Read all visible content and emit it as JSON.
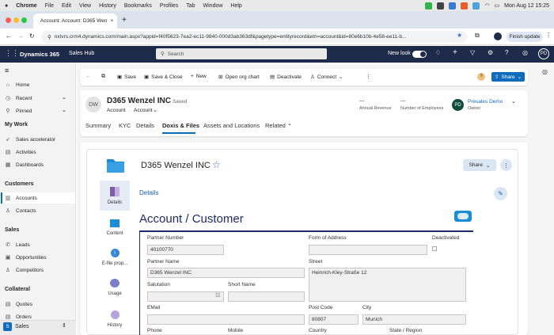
{
  "mac": {
    "apple": "",
    "app": "Chrome",
    "menu": [
      "File",
      "Edit",
      "View",
      "History",
      "Bookmarks",
      "Profiles",
      "Tab",
      "Window",
      "Help"
    ],
    "clock": "Mon Aug 12  15:25"
  },
  "tab": {
    "title": "Account: Account: D365 Wen",
    "close": "×",
    "new": "+"
  },
  "address": {
    "url": "nxtvrs.crm4.dynamics.com/main.aspx?appid=f40f5623-7ea2-ec11-9840-000d3ab363df&pagetype=entityrecord&etn=account&id=80e6b10b-4e58-ee11-b...",
    "finish": "Finish update"
  },
  "dyn": {
    "product": "Dynamics 365",
    "app": "Sales Hub",
    "search_placeholder": "Search",
    "new_look": "New look",
    "avatar": "PD"
  },
  "sidebar": {
    "home": "Home",
    "recent": "Recent",
    "pinned": "Pinned",
    "section_mywork": "My Work",
    "mywork": [
      "Sales accelerator",
      "Activities",
      "Dashboards"
    ],
    "section_customers": "Customers",
    "customers": [
      "Accounts",
      "Contacts"
    ],
    "section_sales": "Sales",
    "sales": [
      "Leads",
      "Opportunities",
      "Competitors"
    ],
    "section_collateral": "Collateral",
    "collateral": [
      "Quotes",
      "Orders"
    ],
    "area": "Sales",
    "area_badge": "S"
  },
  "commands": {
    "save": "Save",
    "save_close": "Save & Close",
    "new": "New",
    "org_chart": "Open org chart",
    "deactivate": "Deactivate",
    "connect": "Connect",
    "share": "Share"
  },
  "record": {
    "initials": "DW",
    "name": "D365 Wenzel INC",
    "saved": "- Saved",
    "type1": "Account",
    "type2": "Account",
    "revenue_value": "---",
    "revenue_label": "Annual Revenue",
    "employees_value": "---",
    "employees_label": "Number of Employees",
    "owner_initials": "PD",
    "owner_name": "Presales Demo",
    "owner_label": "Owner"
  },
  "tabs": [
    "Summary",
    "KYC",
    "Details",
    "Doxis & Files",
    "Assets and Locations",
    "Related"
  ],
  "doxis": {
    "title": "D365 Wenzel INC",
    "share": "Share",
    "nav": [
      "Details",
      "Content",
      "E-file prop...",
      "Usage",
      "History"
    ],
    "section": "Details",
    "form_title": "Account / Customer",
    "fields": {
      "partner_number_label": "Partner Number",
      "partner_number": "40100770",
      "form_of_address_label": "Form of Address",
      "form_of_address": "",
      "deactivated_label": "Deactivated",
      "partner_name_label": "Partner Name",
      "partner_name": "D365 Wenzel INC",
      "street_label": "Street",
      "street": "Heinrich-Kley-Straße 12",
      "salutation_label": "Salutation",
      "short_name_label": "Short Name",
      "email_label": "EMail",
      "post_code_label": "Post Code",
      "post_code": "80807",
      "city_label": "City",
      "city": "Munich",
      "phone_label": "Phone",
      "mobile_label": "Mobile",
      "country_label": "Country",
      "state_label": "State / Region"
    }
  }
}
